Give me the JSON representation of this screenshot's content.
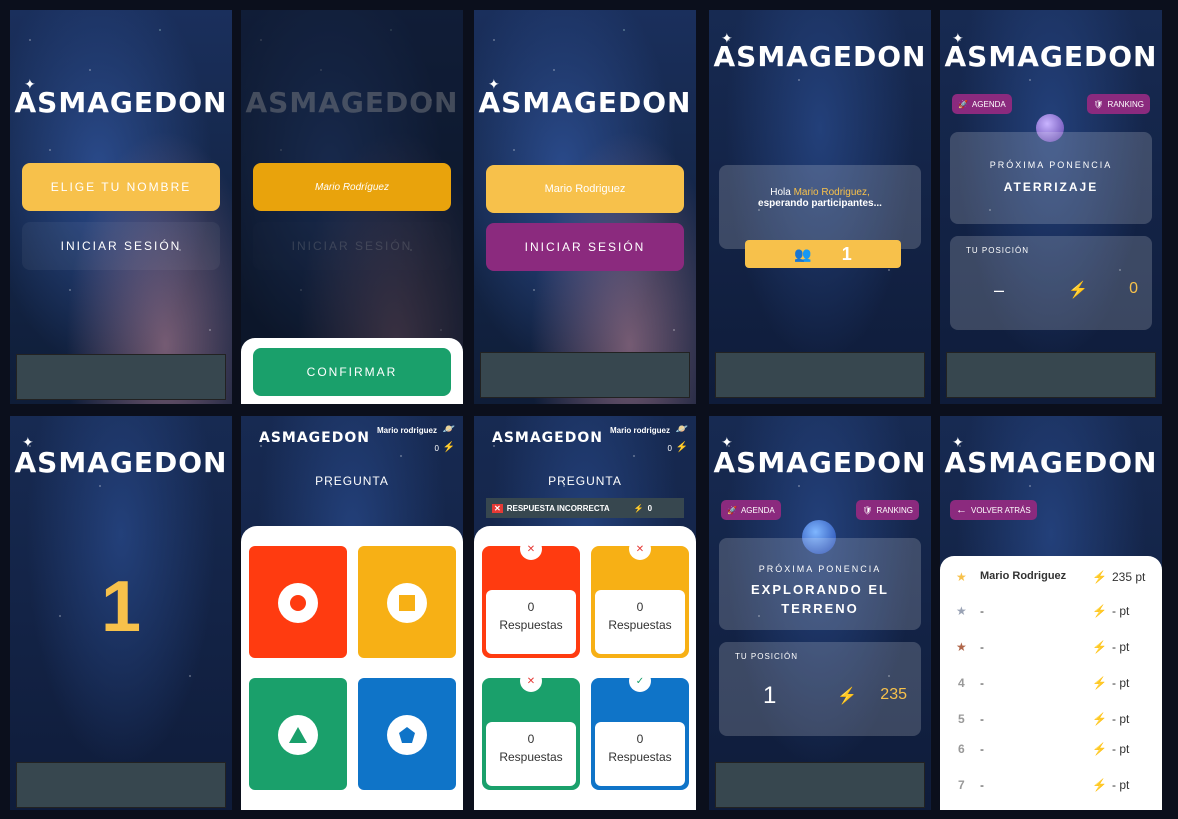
{
  "brand": {
    "logo": "ASMAGEDON"
  },
  "colors": {
    "yellow": "#f7c14b",
    "purple": "#8b2a7e",
    "green": "#1aa06b",
    "red": "#ff3b10",
    "orange": "#f7b015",
    "blue": "#0f74c8"
  },
  "login": {
    "choose_name": "ELIGE TU NOMBRE",
    "login": "INICIAR SESIÓN",
    "name_input_value": "Mario Rodríguez",
    "confirm": "CONFIRMAR",
    "name_filled": "Mario Rodriguez"
  },
  "waiting": {
    "hello": "Hola",
    "user": "Mario Rodriguez,",
    "message": "esperando participantes...",
    "count": "1"
  },
  "lobby1": {
    "agenda": "AGENDA",
    "ranking": "RANKING",
    "next_label": "PRÓXIMA PONENCIA",
    "next_title": "ATERRIZAJE",
    "position_label": "TU POSICIÓN",
    "position": "–",
    "points": "0"
  },
  "countdown": {
    "number": "1"
  },
  "question": {
    "user": "Mario rodriguez",
    "score": "0",
    "title": "PREGUNTA",
    "wrong_banner": "RESPUESTA INCORRECTA",
    "wrong_score": "0",
    "answers": [
      {
        "count": "0",
        "label": "Respuestas"
      },
      {
        "count": "0",
        "label": "Respuestas"
      },
      {
        "count": "0",
        "label": "Respuestas"
      },
      {
        "count": "0",
        "label": "Respuestas"
      }
    ]
  },
  "lobby2": {
    "agenda": "AGENDA",
    "ranking": "RANKING",
    "next_label": "PRÓXIMA PONENCIA",
    "next_title_1": "EXPLORANDO EL",
    "next_title_2": "TERRENO",
    "position_label": "TU POSICIÓN",
    "position": "1",
    "points": "235"
  },
  "ranking": {
    "back": "VOLVER ATRÁS",
    "rows": [
      {
        "rank": "",
        "name": "Mario Rodriguez",
        "points": "235 pt"
      },
      {
        "rank": "",
        "name": "-",
        "points": "- pt"
      },
      {
        "rank": "",
        "name": "-",
        "points": "- pt"
      },
      {
        "rank": "4",
        "name": "-",
        "points": "- pt"
      },
      {
        "rank": "5",
        "name": "-",
        "points": "- pt"
      },
      {
        "rank": "6",
        "name": "-",
        "points": "- pt"
      },
      {
        "rank": "7",
        "name": "-",
        "points": "- pt"
      }
    ]
  }
}
